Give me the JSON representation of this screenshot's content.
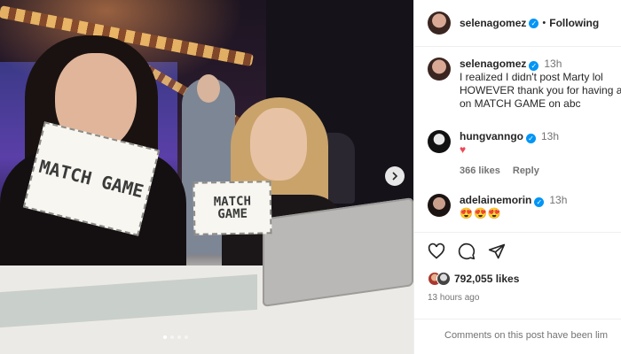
{
  "post": {
    "carousel": {
      "dots": 4,
      "active_index": 0,
      "next_icon": "chevron-right-icon"
    },
    "photo_cards": {
      "card1": "MATCH GAME",
      "card2": "MATCH GAME"
    }
  },
  "header": {
    "username": "selenagomez",
    "separator": "•",
    "follow_label": "Following"
  },
  "comments": [
    {
      "username": "selenagomez",
      "time": "13h",
      "lines": [
        "I realized I didn't post Marty lol",
        "HOWEVER thank you for having a",
        "on MATCH GAME on abc"
      ]
    },
    {
      "username": "hungvanngo",
      "time": "13h",
      "text": "♥",
      "likes_label": "366 likes",
      "reply_label": "Reply"
    },
    {
      "username": "adelainemorin",
      "time": "13h",
      "text": "😍😍😍"
    }
  ],
  "actions": {
    "like_icon": "heart-icon",
    "comment_icon": "comment-icon",
    "share_icon": "send-icon",
    "likes_count": "792,055 likes",
    "posted_time": "13 hours ago"
  },
  "footer": {
    "comments_closed": "Comments on this post have been lim"
  },
  "colors": {
    "verified": "#0095f6",
    "heart": "#ed4956",
    "muted": "#737373"
  }
}
